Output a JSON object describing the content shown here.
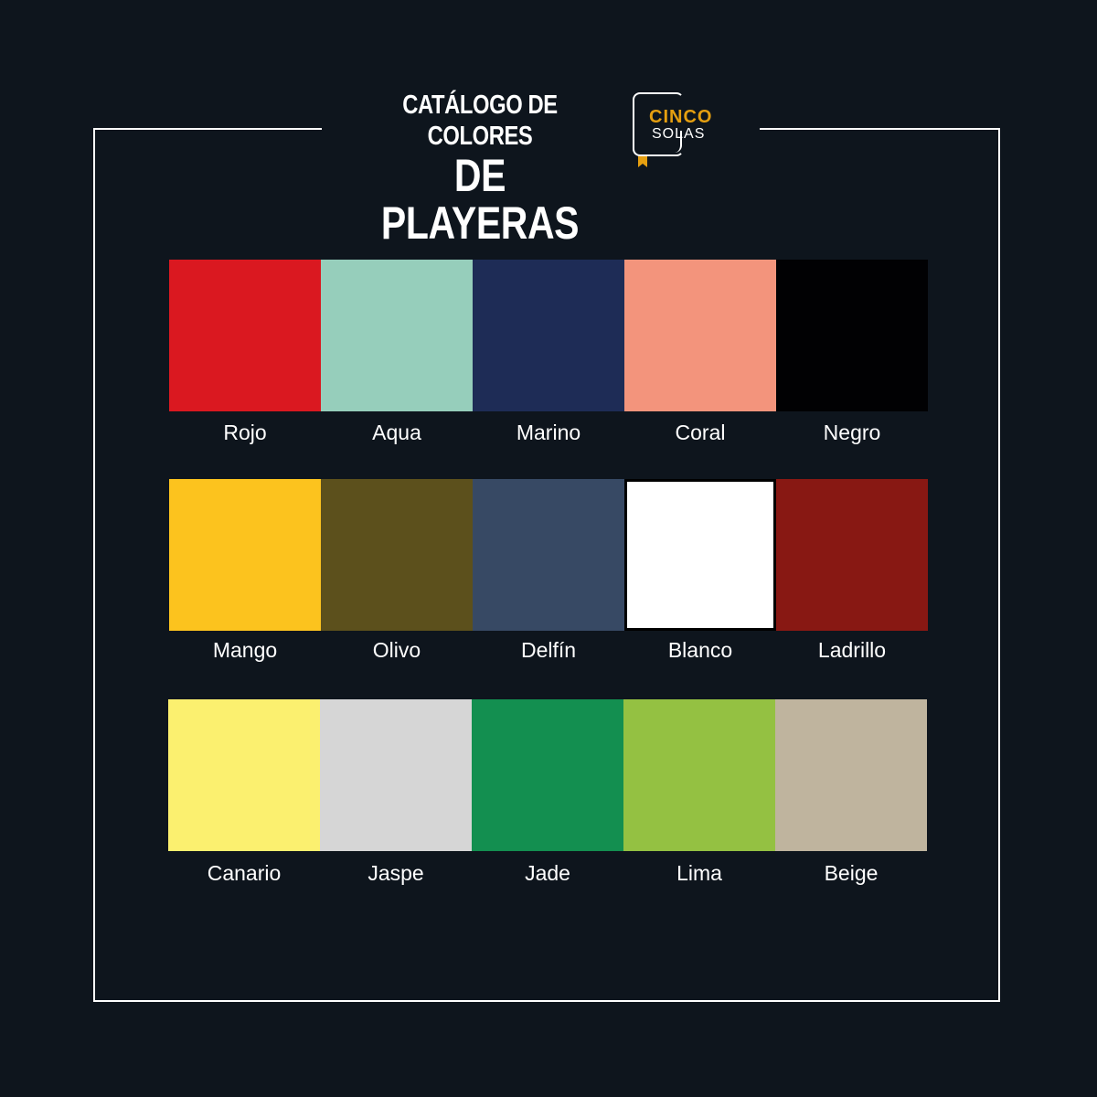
{
  "title": {
    "line1": "CATÁLOGO DE COLORES",
    "line2": "DE PLAYERAS"
  },
  "logo": {
    "word1": "CINCO",
    "word2": "SOLAS",
    "icon": "book-bookmark-icon",
    "accent_color": "#e59f10"
  },
  "colors": [
    [
      {
        "name": "Rojo",
        "hex": "#da1820"
      },
      {
        "name": "Aqua",
        "hex": "#96cebb"
      },
      {
        "name": "Marino",
        "hex": "#1e2c56"
      },
      {
        "name": "Coral",
        "hex": "#f3947c"
      },
      {
        "name": "Negro",
        "hex": "#010103"
      }
    ],
    [
      {
        "name": "Mango",
        "hex": "#fcc31e"
      },
      {
        "name": "Olivo",
        "hex": "#5c501c"
      },
      {
        "name": "Delfín",
        "hex": "#374964"
      },
      {
        "name": "Blanco",
        "hex": "#ffffff"
      },
      {
        "name": "Ladrillo",
        "hex": "#881813"
      }
    ],
    [
      {
        "name": "Canario",
        "hex": "#fbf06f"
      },
      {
        "name": "Jaspe",
        "hex": "#d6d6d6"
      },
      {
        "name": "Jade",
        "hex": "#138f50"
      },
      {
        "name": "Lima",
        "hex": "#94c142"
      },
      {
        "name": "Beige",
        "hex": "#bfb49e"
      }
    ]
  ]
}
